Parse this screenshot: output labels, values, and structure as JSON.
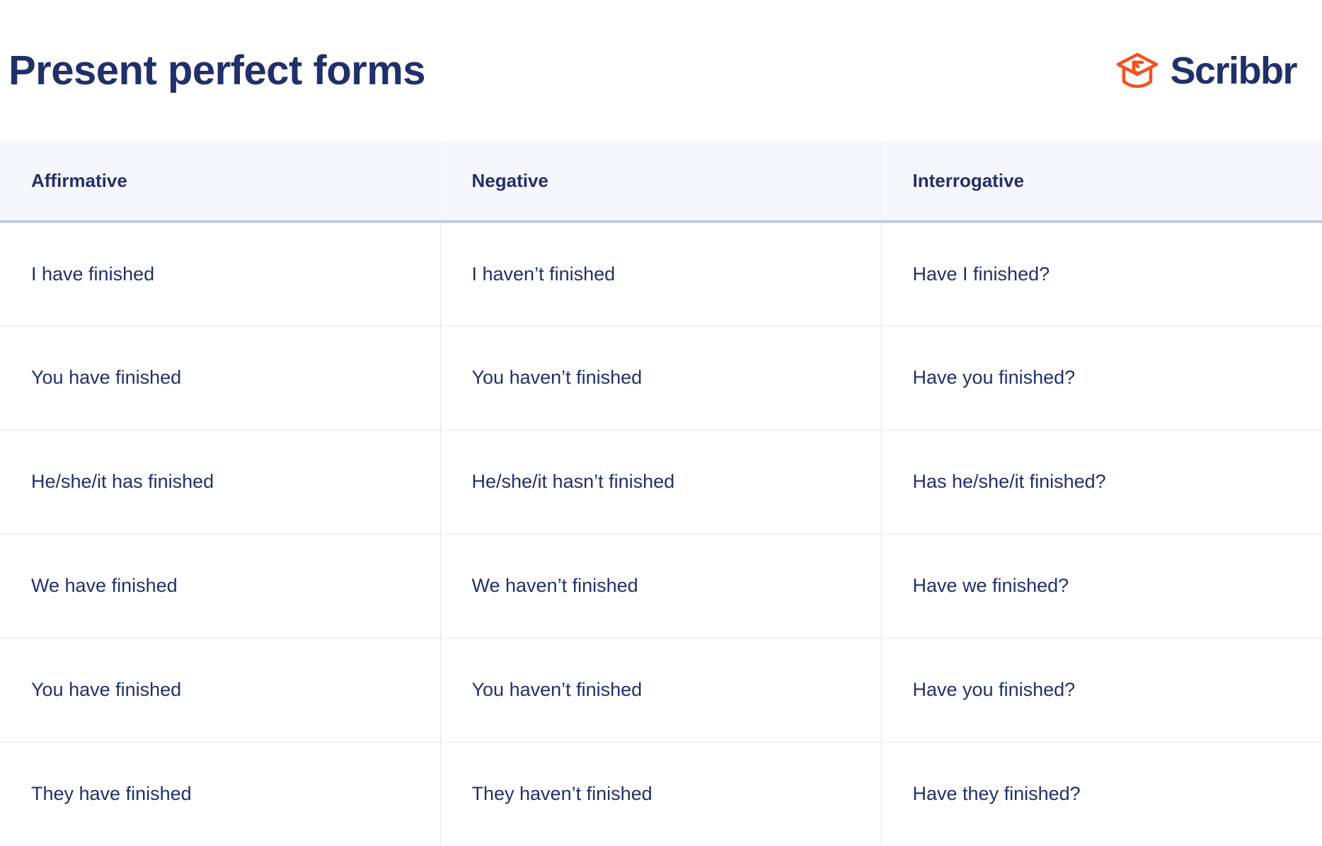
{
  "header": {
    "title": "Present perfect forms",
    "logo": {
      "wordmark": "Scribbr",
      "mark_icon": "graduation-cap-icon",
      "mark_color": "#f4511e",
      "word_color": "#21306b"
    }
  },
  "theme": {
    "text_navy": "#21306b",
    "header_bg": "#f6f7fc",
    "header_rule": "#c3cadf",
    "row_rule": "#e3e7f2",
    "column_rule": "#dfe4f0",
    "page_bg": "#ffffff",
    "accent_orange": "#f4511e"
  },
  "table": {
    "columns": [
      "Affirmative",
      "Negative",
      "Interrogative"
    ],
    "rows": [
      {
        "affirmative": "I have finished",
        "negative": "I haven’t finished",
        "interrogative": "Have I finished?"
      },
      {
        "affirmative": "You have finished",
        "negative": "You haven’t finished",
        "interrogative": "Have you finished?"
      },
      {
        "affirmative": "He/she/it has finished",
        "negative": "He/she/it hasn’t finished",
        "interrogative": "Has he/she/it finished?"
      },
      {
        "affirmative": "We have finished",
        "negative": "We haven’t finished",
        "interrogative": "Have we finished?"
      },
      {
        "affirmative": "You have finished",
        "negative": "You haven’t finished",
        "interrogative": "Have you finished?"
      },
      {
        "affirmative": "They have finished",
        "negative": "They haven’t finished",
        "interrogative": "Have they finished?"
      }
    ]
  }
}
